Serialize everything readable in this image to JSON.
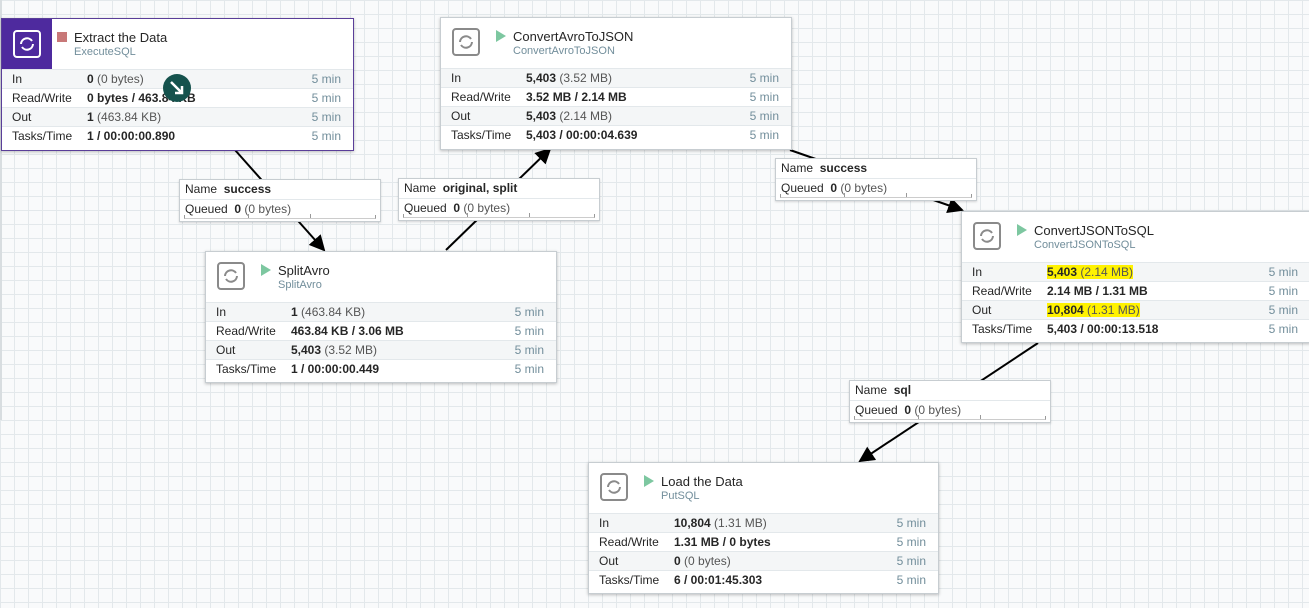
{
  "processors": {
    "extract": {
      "name": "Extract the Data",
      "type": "ExecuteSQL",
      "status": "stopped",
      "stats": [
        {
          "label": "In",
          "value": "0",
          "size": "(0 bytes)",
          "time": "5 min"
        },
        {
          "label": "Read/Write",
          "value": "0 bytes / 463.84 KB",
          "size": "",
          "time": "5 min"
        },
        {
          "label": "Out",
          "value": "1",
          "size": "(463.84 KB)",
          "time": "5 min"
        },
        {
          "label": "Tasks/Time",
          "value": "1 / 00:00:00.890",
          "size": "",
          "time": "5 min"
        }
      ]
    },
    "convertAvro": {
      "name": "ConvertAvroToJSON",
      "type": "ConvertAvroToJSON",
      "status": "running",
      "stats": [
        {
          "label": "In",
          "value": "5,403",
          "size": "(3.52 MB)",
          "time": "5 min"
        },
        {
          "label": "Read/Write",
          "value": "3.52 MB / 2.14 MB",
          "size": "",
          "time": "5 min"
        },
        {
          "label": "Out",
          "value": "5,403",
          "size": "(2.14 MB)",
          "time": "5 min"
        },
        {
          "label": "Tasks/Time",
          "value": "5,403 / 00:00:04.639",
          "size": "",
          "time": "5 min"
        }
      ]
    },
    "splitAvro": {
      "name": "SplitAvro",
      "type": "SplitAvro",
      "status": "running",
      "stats": [
        {
          "label": "In",
          "value": "1",
          "size": "(463.84 KB)",
          "time": "5 min"
        },
        {
          "label": "Read/Write",
          "value": "463.84 KB / 3.06 MB",
          "size": "",
          "time": "5 min"
        },
        {
          "label": "Out",
          "value": "5,403",
          "size": "(3.52 MB)",
          "time": "5 min"
        },
        {
          "label": "Tasks/Time",
          "value": "1 / 00:00:00.449",
          "size": "",
          "time": "5 min"
        }
      ]
    },
    "convertJson": {
      "name": "ConvertJSONToSQL",
      "type": "ConvertJSONToSQL",
      "status": "running",
      "stats": [
        {
          "label": "In",
          "value": "5,403",
          "size": "(2.14 MB)",
          "time": "5 min"
        },
        {
          "label": "Read/Write",
          "value": "2.14 MB / 1.31 MB",
          "size": "",
          "time": "5 min"
        },
        {
          "label": "Out",
          "value": "10,804",
          "size": "(1.31 MB)",
          "time": "5 min"
        },
        {
          "label": "Tasks/Time",
          "value": "5,403 / 00:00:13.518",
          "size": "",
          "time": "5 min"
        }
      ]
    },
    "load": {
      "name": "Load the Data",
      "type": "PutSQL",
      "status": "running",
      "stats": [
        {
          "label": "In",
          "value": "10,804",
          "size": "(1.31 MB)",
          "time": "5 min"
        },
        {
          "label": "Read/Write",
          "value": "1.31 MB / 0 bytes",
          "size": "",
          "time": "5 min"
        },
        {
          "label": "Out",
          "value": "0",
          "size": "(0 bytes)",
          "time": "5 min"
        },
        {
          "label": "Tasks/Time",
          "value": "6 / 00:01:45.303",
          "size": "",
          "time": "5 min"
        }
      ]
    }
  },
  "connections": {
    "c1": {
      "name_label": "Name",
      "name": "success",
      "queued_label": "Queued",
      "queued_count": "0",
      "queued_size": "(0 bytes)"
    },
    "c2": {
      "name_label": "Name",
      "name": "original, split",
      "queued_label": "Queued",
      "queued_count": "0",
      "queued_size": "(0 bytes)"
    },
    "c3": {
      "name_label": "Name",
      "name": "success",
      "queued_label": "Queued",
      "queued_count": "0",
      "queued_size": "(0 bytes)"
    },
    "c4": {
      "name_label": "Name",
      "name": "sql",
      "queued_label": "Queued",
      "queued_count": "0",
      "queued_size": "(0 bytes)"
    }
  },
  "highlight_color": "#fff200",
  "selected_color": "#4e2a9e"
}
